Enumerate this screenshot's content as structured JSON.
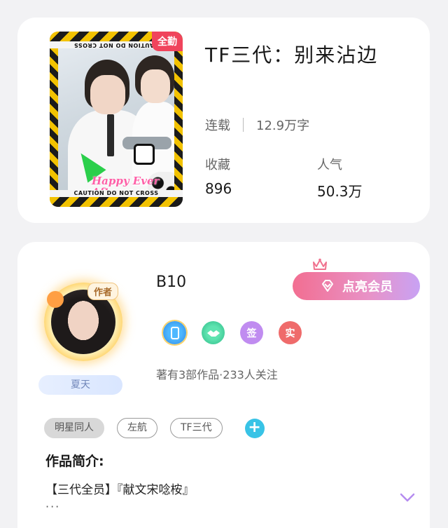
{
  "book": {
    "title": "TF三代：别来沾边",
    "badge": "全勤",
    "status": "连载",
    "word_count": "12.9万字",
    "favorites_label": "收藏",
    "favorites_value": "896",
    "popularity_label": "人气",
    "popularity_value": "50.3万",
    "cover": {
      "tape_text_top": "CAUTION DO NOT CROSS",
      "tape_text_bottom": "CAUTION DO NOT CROSS",
      "script_text": "Happy Ever After"
    }
  },
  "author": {
    "name": "B10",
    "avatar_tag": "作者",
    "nickname": "夏天",
    "vip_button_label": "点亮会员",
    "badges": [
      {
        "icon": "phone-badge-icon",
        "text": ""
      },
      {
        "icon": "handshake-badge-icon",
        "text": ""
      },
      {
        "icon": "sign-badge-icon",
        "text": "签"
      },
      {
        "icon": "real-badge-icon",
        "text": "实"
      }
    ],
    "stats": "著有3部作品·233人关注"
  },
  "tags": [
    "明星同人",
    "左航",
    "TF三代"
  ],
  "intro": {
    "heading": "作品简介:",
    "text": "【三代全员】『献文宋唸桉』",
    "more": "···"
  },
  "colors": {
    "badge_red": "#f0445c",
    "vip_gradient_start": "#f26e91",
    "vip_gradient_end": "#c8a2f4",
    "add_tag_blue": "#38c3e6",
    "expand_purple": "#b58cf0"
  }
}
